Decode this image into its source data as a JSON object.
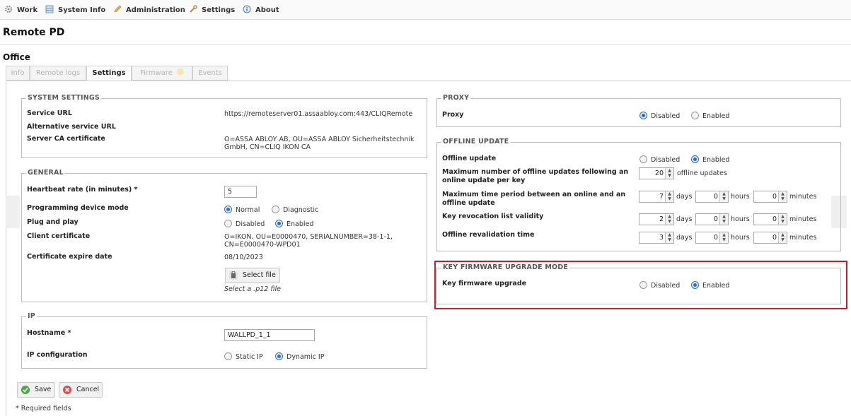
{
  "menu": {
    "items": [
      {
        "label": "Work",
        "icon": "gear-icon"
      },
      {
        "label": "System Info",
        "icon": "info-table-icon"
      },
      {
        "label": "Administration",
        "icon": "pencil-icon"
      },
      {
        "label": "Settings",
        "icon": "wrench-icon"
      },
      {
        "label": "About",
        "icon": "info-circle-icon"
      }
    ]
  },
  "page": {
    "title": "Remote PD",
    "subtitle": "Office"
  },
  "tabs": [
    {
      "label": "Info",
      "active": false
    },
    {
      "label": "Remote logs",
      "active": false
    },
    {
      "label": "Settings",
      "active": true
    },
    {
      "label": "Firmware",
      "active": false
    },
    {
      "label": "Events",
      "active": false
    }
  ],
  "system_settings": {
    "legend": "SYSTEM SETTINGS",
    "service_url_label": "Service URL",
    "service_url_value": "https://remoteserver01.assaabloy.com:443/CLIQRemote",
    "alt_service_url_label": "Alternative service URL",
    "server_ca_label": "Server CA certificate",
    "server_ca_value_line1": "O=ASSA ABLOY AB, OU=ASSA ABLOY Sicherheitstechnik",
    "server_ca_value_line2": "GmbH, CN=CLIQ IKON CA"
  },
  "general": {
    "legend": "GENERAL",
    "heartbeat_label": "Heartbeat rate (in minutes) *",
    "heartbeat_value": "5",
    "prog_mode_label": "Programming device mode",
    "prog_mode_options": [
      "Normal",
      "Diagnostic"
    ],
    "prog_mode_selected": "Normal",
    "plug_play_label": "Plug and play",
    "plug_play_options": [
      "Disabled",
      "Enabled"
    ],
    "plug_play_selected": "Enabled",
    "client_cert_label": "Client certificate",
    "client_cert_value_line1": "O=IKON, OU=E0000470, SERIALNUMBER=38-1-1,",
    "client_cert_value_line2": "CN=E0000470-WPD01",
    "cert_expire_label": "Certificate expire date",
    "cert_expire_value": "08/10/2023",
    "select_file_label": "Select file",
    "select_file_hint": "Select a .p12 file"
  },
  "ip": {
    "legend": "IP",
    "hostname_label": "Hostname *",
    "hostname_value": "WALLPD_1_1",
    "ip_config_label": "IP configuration",
    "ip_config_options": [
      "Static IP",
      "Dynamic IP"
    ],
    "ip_config_selected": "Dynamic IP"
  },
  "actions": {
    "save_label": "Save",
    "cancel_label": "Cancel",
    "required_note": "* Required fields"
  },
  "proxy": {
    "legend": "PROXY",
    "proxy_label": "Proxy",
    "options": [
      "Disabled",
      "Enabled"
    ],
    "selected": "Disabled"
  },
  "offline_update": {
    "legend": "OFFLINE UPDATE",
    "offline_update_label": "Offline update",
    "options": [
      "Disabled",
      "Enabled"
    ],
    "selected": "Enabled",
    "max_updates_label_line1": "Maximum number of offline updates following an",
    "max_updates_label_line2": "online update per key",
    "max_updates_value": "20",
    "max_updates_unit": "offline updates",
    "max_period_label_line1": "Maximum time period between an online and an",
    "max_period_label_line2": "offline update",
    "max_period_days": "7",
    "max_period_hours": "0",
    "max_period_minutes": "0",
    "krl_label": "Key revocation list validity",
    "krl_days": "2",
    "krl_hours": "0",
    "krl_minutes": "0",
    "revalidation_label": "Offline revalidation time",
    "revalidation_days": "3",
    "revalidation_hours": "0",
    "revalidation_minutes": "0",
    "unit_days": "days",
    "unit_hours": "hours",
    "unit_minutes": "minutes"
  },
  "key_firmware": {
    "legend": "KEY FIRMWARE UPGRADE MODE",
    "label": "Key firmware upgrade",
    "options": [
      "Disabled",
      "Enabled"
    ],
    "selected": "Enabled"
  },
  "colors": {
    "highlight": "#c81e2a",
    "radio_selected": "#2f6fb8"
  }
}
